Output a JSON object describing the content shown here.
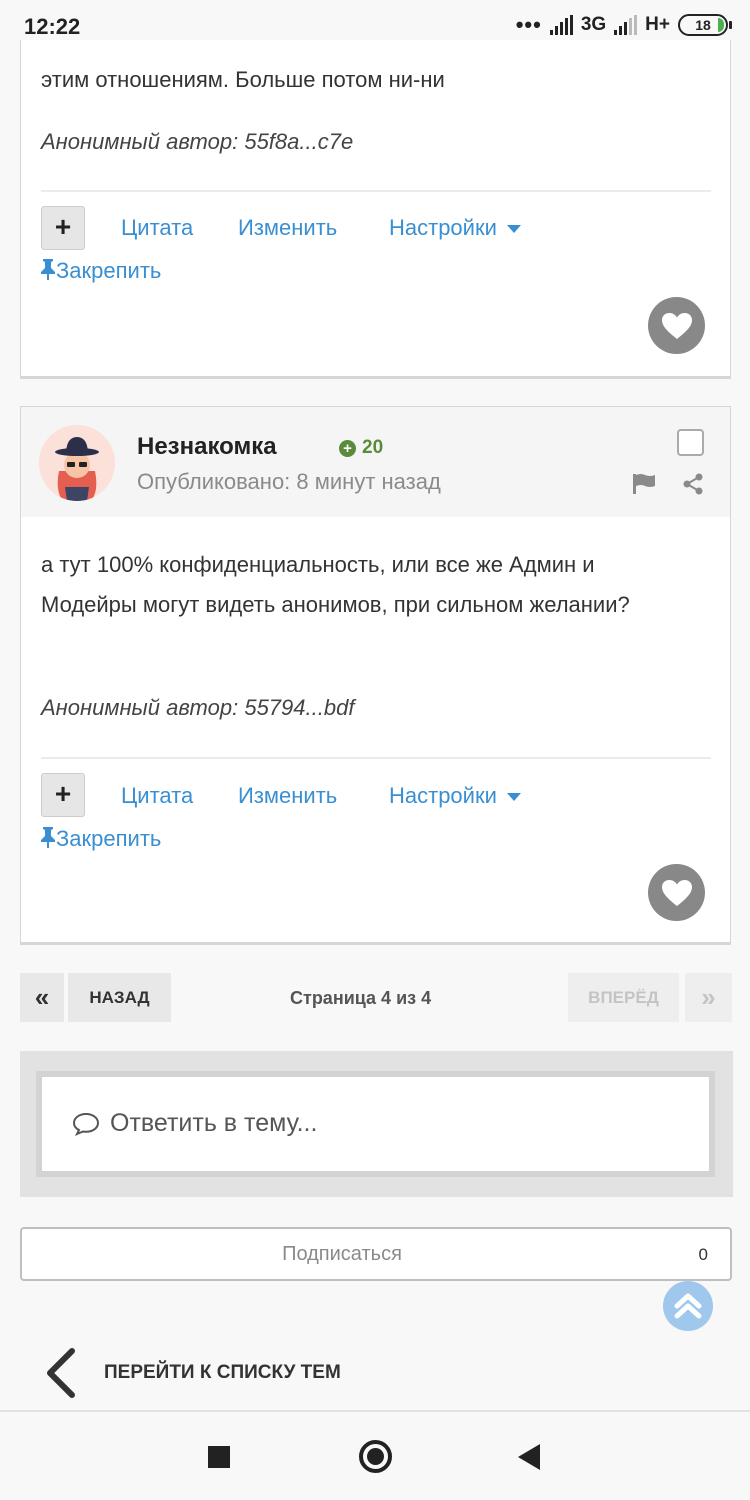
{
  "status_bar": {
    "time": "12:22",
    "network_3g": "3G",
    "network_hplus": "H+",
    "battery": "18"
  },
  "post1": {
    "text_tail": "этим отношениям. Больше  потом ни-ни",
    "anon_author": "Анонимный автор: 55f8a...c7e",
    "actions": {
      "plus": "+",
      "quote": "Цитата",
      "edit": "Изменить",
      "settings": "Настройки",
      "pin": "Закрепить"
    }
  },
  "post2": {
    "author": "Незнакомка",
    "reputation": "20",
    "published": "Опубликовано: 8 минут назад",
    "text": "а тут 100% конфиденциальность, или все же Админ и Модейры  могут видеть анонимов, при сильном желании?",
    "anon_author": "Анонимный автор: 55794...bdf",
    "actions": {
      "plus": "+",
      "quote": "Цитата",
      "edit": "Изменить",
      "settings": "Настройки",
      "pin": "Закрепить"
    }
  },
  "pagination": {
    "first": "«",
    "prev": "НАЗАД",
    "info": "Страница 4 из 4",
    "next": "ВПЕРЁД",
    "last": "»"
  },
  "reply": {
    "placeholder": "Ответить в тему..."
  },
  "subscribe": {
    "label": "Подписаться",
    "count": "0"
  },
  "back_to_list": "ПЕРЕЙТИ К СПИСКУ ТЕМ",
  "colors": {
    "link": "#3a8fd2",
    "reputation": "#5a8b3c",
    "like_button": "#888888"
  }
}
